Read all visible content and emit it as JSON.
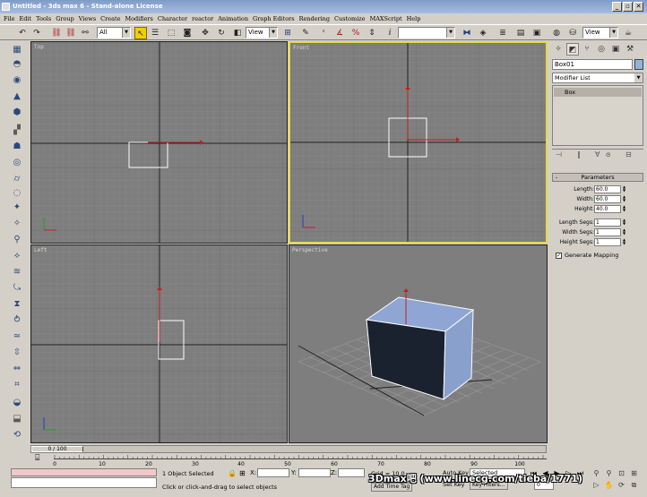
{
  "window": {
    "title": "Untitled - 3ds max 6 - Stand-alone License",
    "minimize": "_",
    "restore": "▫",
    "close": "✕"
  },
  "menu": [
    "File",
    "Edit",
    "Tools",
    "Group",
    "Views",
    "Create",
    "Modifiers",
    "Character",
    "reactor",
    "Animation",
    "Graph Editors",
    "Rendering",
    "Customize",
    "MAXScript",
    "Help"
  ],
  "toolbar": {
    "selection_filter": "All",
    "ref_coord": "View",
    "named_selection": "",
    "render_type": "View"
  },
  "viewports": {
    "top": "Top",
    "front": "Front",
    "left": "Left",
    "perspective": "Perspective"
  },
  "command_panel": {
    "object_name": "Box01",
    "modifier_list": "Modifier List",
    "stack_item": "Box",
    "rollout_title": "Parameters",
    "params": [
      {
        "label": "Length:",
        "value": "60.0"
      },
      {
        "label": "Width:",
        "value": "60.0"
      },
      {
        "label": "Height:",
        "value": "40.0"
      }
    ],
    "segs": [
      {
        "label": "Length Segs:",
        "value": "1"
      },
      {
        "label": "Width Segs:",
        "value": "1"
      },
      {
        "label": "Height Segs:",
        "value": "1"
      }
    ],
    "generate_mapping": "Generate Mapping",
    "generate_mapping_checked": "✓"
  },
  "timeline": {
    "slider_label": "0 / 100",
    "ticks": [
      "0",
      "10",
      "20",
      "30",
      "40",
      "50",
      "60",
      "70",
      "80",
      "90",
      "100"
    ]
  },
  "status": {
    "selection": "1 Object Selected",
    "x_label": "X:",
    "y_label": "Y:",
    "z_label": "Z:",
    "grid": "Grid = 10.0",
    "prompt": "Click or click-and-drag to select objects",
    "add_time_tag": "Add Time Tag",
    "auto_key": "Auto Key",
    "auto_key_mode": "Selected",
    "set_key": "Set Key",
    "key_filters": "Key Filters...",
    "frame": "0",
    "watermark": "3Dmax吧 (www.linecg.com/tieba/1771)"
  },
  "colors": {
    "object_color": "#8fb4e0",
    "active_viewport_border": "#e8d848",
    "viewport_bg": "#7e7e7e"
  }
}
